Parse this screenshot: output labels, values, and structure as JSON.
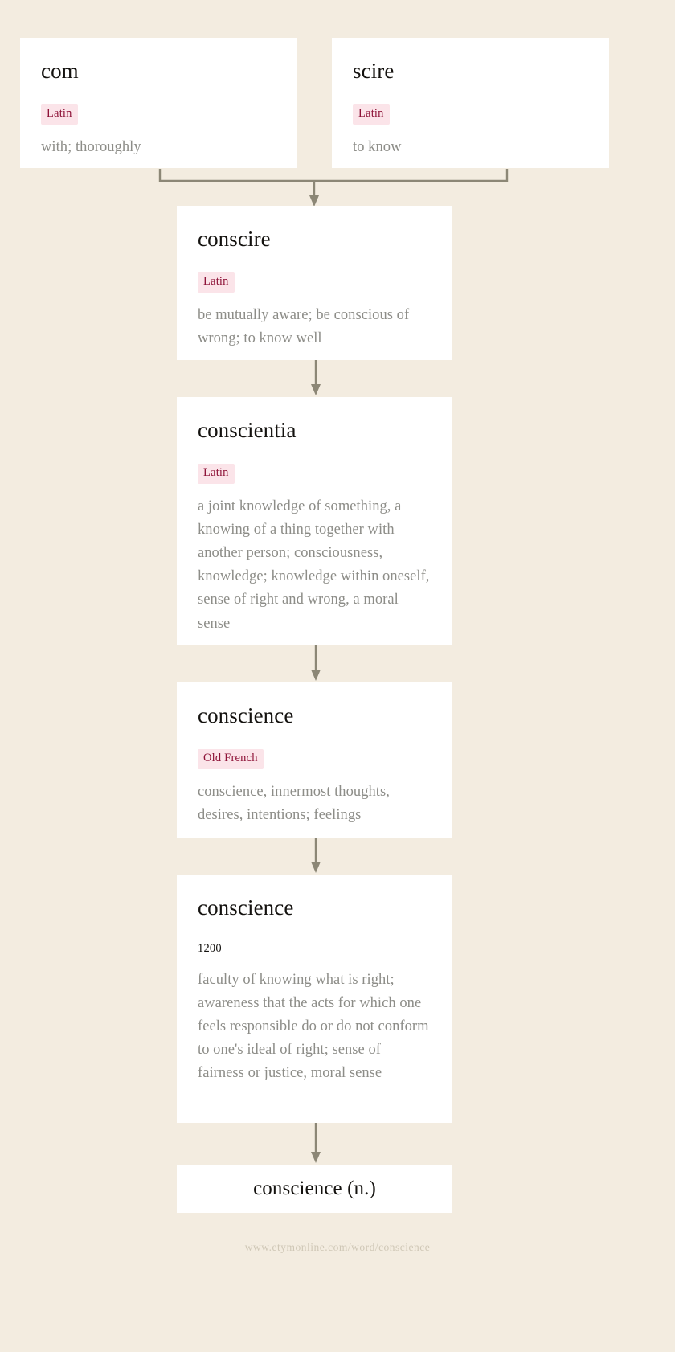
{
  "page": {
    "background_color": "#f3ece0",
    "card_color": "#ffffff",
    "connector_color": "#8c8776",
    "headword_color": "#14120f",
    "definition_color": "#8d8d88",
    "tag_text_color": "#8e1338",
    "tag_background_color": "#fbe4e9",
    "footer_color": "#cfc7b6"
  },
  "footer": {
    "url": "www.etymonline.com/word/conscience"
  },
  "nodes": {
    "com": {
      "headword": "com",
      "tag": "Latin",
      "definition": "with; thoroughly"
    },
    "scire": {
      "headword": "scire",
      "tag": "Latin",
      "definition": "to know"
    },
    "conscire": {
      "headword": "conscire",
      "tag": "Latin",
      "definition": "be mutually aware; be conscious of wrong; to know well"
    },
    "conscientia": {
      "headword": "conscientia",
      "tag": "Latin",
      "definition": "a joint knowledge of something, a knowing of a thing together with another person; consciousness, knowledge; knowledge within oneself, sense of right and wrong, a moral sense"
    },
    "conscience_of": {
      "headword": "conscience",
      "tag": "Old French",
      "definition": "conscience, innermost thoughts, desires, intentions; feelings"
    },
    "conscience_1200": {
      "headword": "conscience",
      "tag": "1200",
      "definition": "faculty of knowing what is right; awareness that the acts for which one feels responsible do or do not conform to one's ideal of right; sense of fairness or justice, moral sense"
    },
    "conscience_entry": {
      "headword": "conscience (n.)"
    }
  }
}
